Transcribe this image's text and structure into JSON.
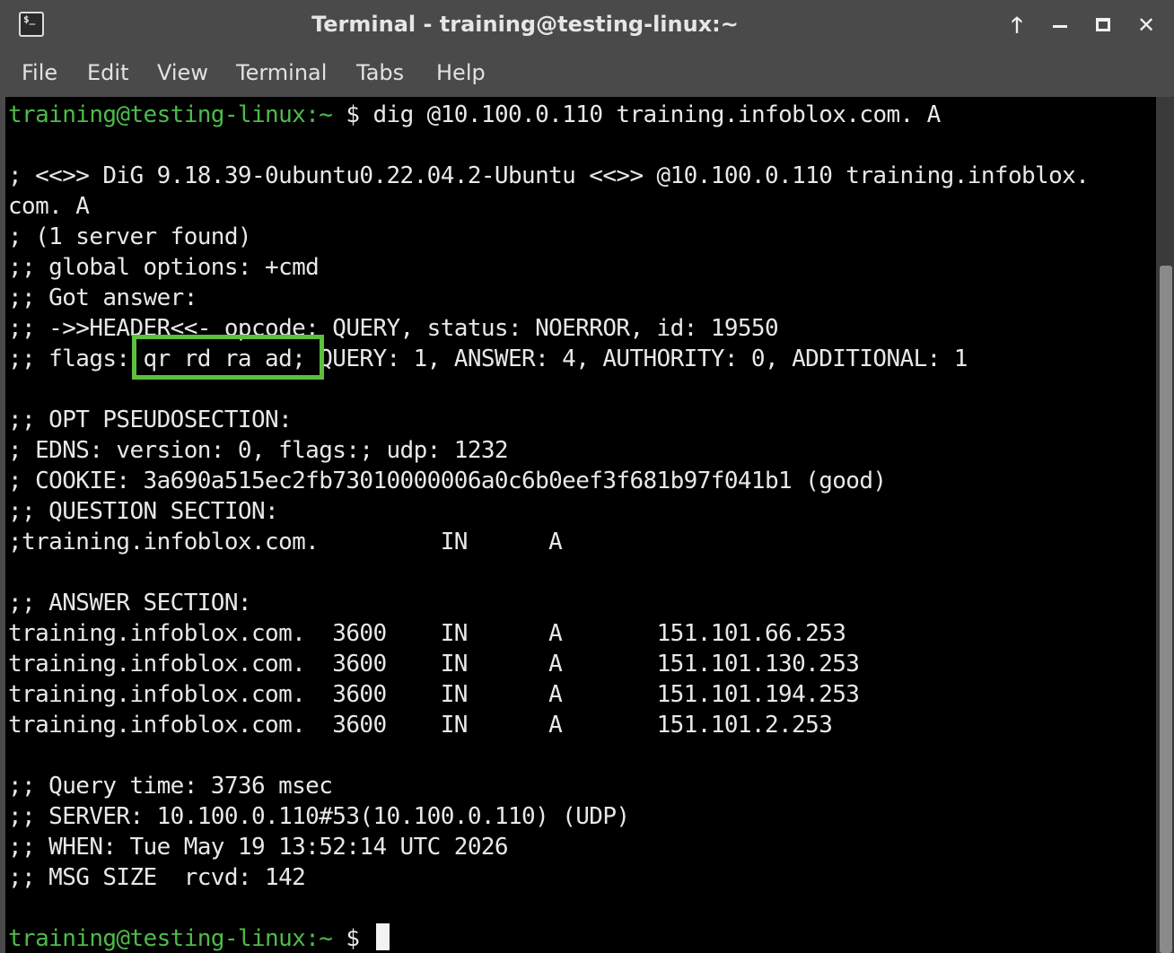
{
  "window": {
    "title": "Terminal - training@testing-linux:~",
    "buttons": {
      "up": "🡑",
      "close": "✕"
    }
  },
  "menu": [
    "File",
    "Edit",
    "View",
    "Terminal",
    "Tabs",
    "Help"
  ],
  "prompt": {
    "user_host": "training@testing-linux",
    "path": ":~",
    "symbol": " $ "
  },
  "command": "dig @10.100.0.110 training.infoblox.com. A",
  "output": [
    "",
    "; <<>> DiG 9.18.39-0ubuntu0.22.04.2-Ubuntu <<>> @10.100.0.110 training.infoblox.",
    "com. A",
    "; (1 server found)",
    ";; global options: +cmd",
    ";; Got answer:",
    ";; ->>HEADER<<- opcode: QUERY, status: NOERROR, id: 19550",
    ";; flags: qr rd ra ad; QUERY: 1, ANSWER: 4, AUTHORITY: 0, ADDITIONAL: 1",
    "",
    ";; OPT PSEUDOSECTION:",
    "; EDNS: version: 0, flags:; udp: 1232",
    "; COOKIE: 3a690a515ec2fb73010000006a0c6b0eef3f681b97f041b1 (good)",
    ";; QUESTION SECTION:",
    ";training.infoblox.com.\t\tIN\tA",
    "",
    ";; ANSWER SECTION:",
    "training.infoblox.com.\t3600\tIN\tA\t151.101.66.253",
    "training.infoblox.com.\t3600\tIN\tA\t151.101.130.253",
    "training.infoblox.com.\t3600\tIN\tA\t151.101.194.253",
    "training.infoblox.com.\t3600\tIN\tA\t151.101.2.253",
    "",
    ";; Query time: 3736 msec",
    ";; SERVER: 10.100.0.110#53(10.100.0.110) (UDP)",
    ";; WHEN: Tue May 19 13:52:14 UTC 2026",
    ";; MSG SIZE  rcvd: 142",
    ""
  ],
  "colors": {
    "prompt": "#4dbb4a",
    "highlight": "#5cbf3d",
    "text": "#e8e8e8"
  }
}
